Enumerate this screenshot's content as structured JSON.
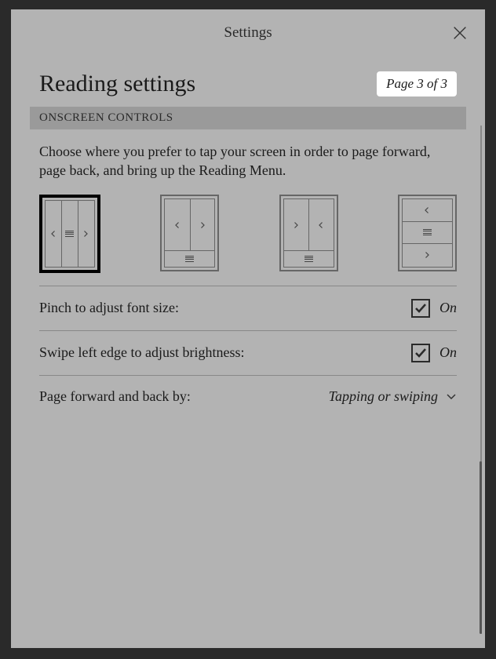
{
  "header": {
    "title": "Settings"
  },
  "page": {
    "title": "Reading settings",
    "badge": "Page 3 of 3"
  },
  "section": {
    "header": "ONSCREEN CONTROLS",
    "description": "Choose where you prefer to tap your screen in order to page forward, page back, and bring up the Reading Menu."
  },
  "settings": {
    "pinch": {
      "label": "Pinch to adjust font size:",
      "value": "On",
      "checked": true
    },
    "swipe": {
      "label": "Swipe left edge to adjust brightness:",
      "value": "On",
      "checked": true
    },
    "pageNav": {
      "label": "Page forward and back by:",
      "value": "Tapping or swiping"
    }
  }
}
